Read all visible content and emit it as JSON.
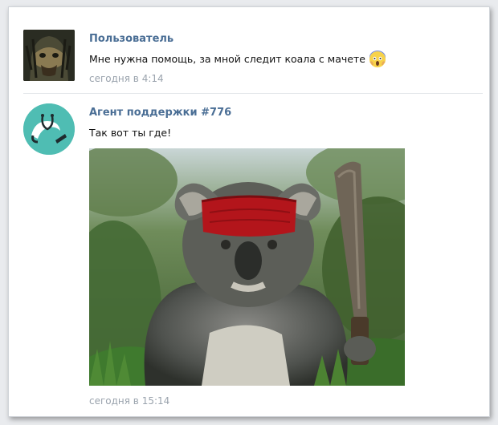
{
  "messages": [
    {
      "author": "Пользователь",
      "text": "Мне нужна помощь, за мной следит коала с мачете",
      "emoji_icon": "face-screaming-in-fear-icon",
      "time": "сегодня в 4:14"
    },
    {
      "author": "Агент поддержки #776",
      "text": "Так вот ты где!",
      "attachment": "photo",
      "time": "сегодня в 15:14"
    }
  ],
  "colors": {
    "author_name": "#4a6e95",
    "timestamp": "#9aa3ad",
    "support_avatar_bg": "#4fbdb3"
  }
}
